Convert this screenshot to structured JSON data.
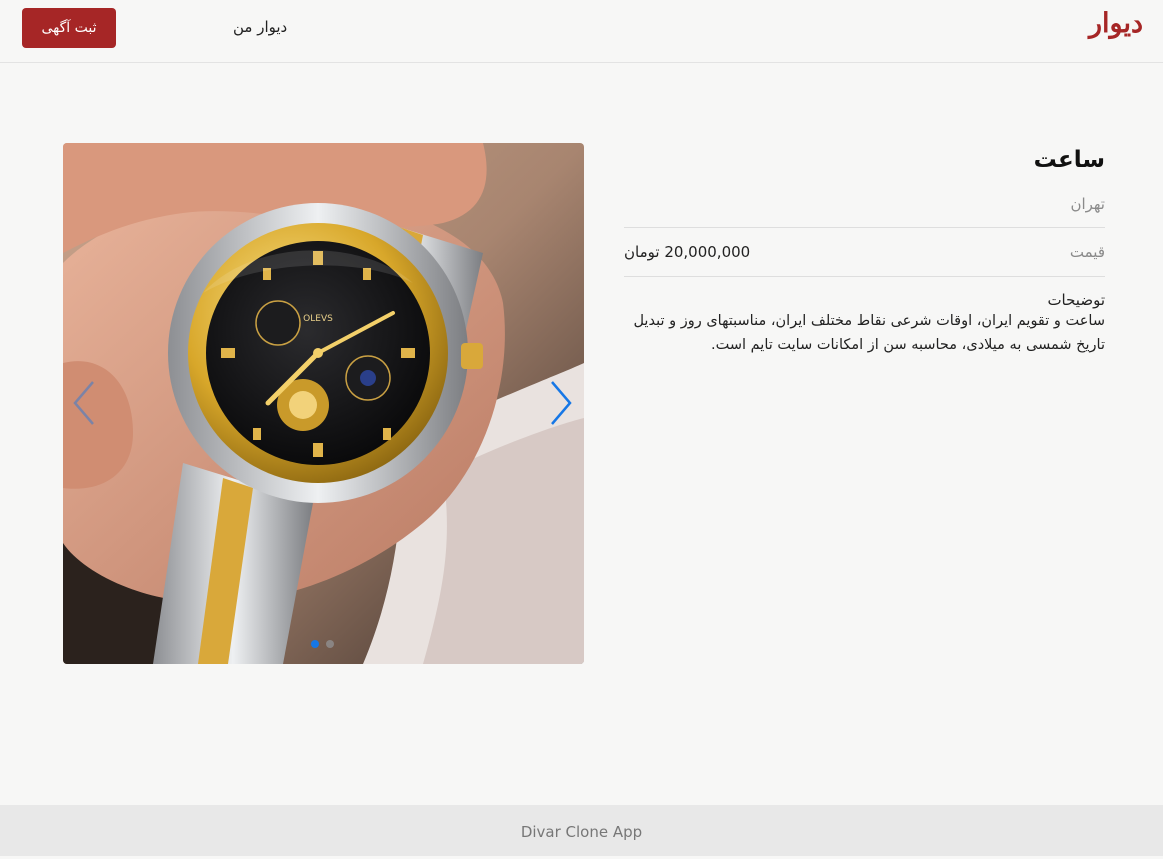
{
  "header": {
    "logo": "دیوار",
    "my_divar": "دیوار من",
    "post_button": "ثبت آگهی"
  },
  "listing": {
    "title": "ساعت",
    "city": "تهران",
    "price_label": "قیمت",
    "price_value": "20,000,000 تومان",
    "description_heading": "توضیحات",
    "description": "ساعت و تقویم ایران، اوقات شرعی نقاط مختلف ایران، مناسبتهای روز و تبدیل تاریخ شمسی به میلادی، محاسبه سن از امکانات سایت تایم است."
  },
  "gallery": {
    "image_count": 2,
    "active_index": 0,
    "active_dot_color": "#1677e6",
    "inactive_dot_color": "#9aa0a6",
    "arrow_color": "#1677e6",
    "watch_brand": "OLEVS"
  },
  "footer": {
    "text": "Divar Clone App"
  },
  "colors": {
    "brand": "#a62626",
    "background": "#f7f7f6",
    "footer_bg": "#e8e8e8"
  }
}
